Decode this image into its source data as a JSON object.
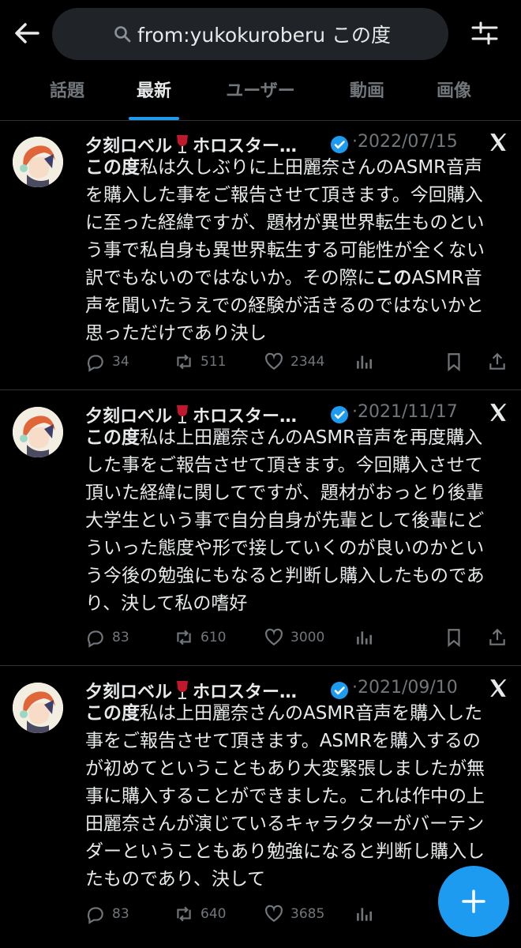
{
  "search": {
    "query": "from:yukokuroberu この度"
  },
  "tabs": [
    "話題",
    "最新",
    "ユーザー",
    "動画",
    "画像"
  ],
  "tweets": [
    {
      "name_part1": "夕刻ロベル",
      "name_part2": "ホロスター…",
      "date": "·2022/07/15",
      "text_bold_start": "この度",
      "text_a": "私は久しぶりに上田麗奈さんのASMR音声を購入した事をご報告させて頂きます。今回購入に至った経緯ですが、題材が異世界転生ものという事で私自身も異世界転生する可能性が全くない訳でもないのではないか。その際に",
      "text_bold_mid": "この",
      "text_b": "ASMR音声を聞いたうえでの経験が活きるのではないかと思っただけであり決し",
      "replies": "34",
      "retweets": "511",
      "likes": "2344"
    },
    {
      "name_part1": "夕刻ロベル",
      "name_part2": "ホロスター…",
      "date": "·2021/11/17",
      "text_bold_start": "この度",
      "text_a": "私は上田麗奈さんのASMR音声を再度購入した事をご報告させて頂きます。今回購入させて頂いた経緯に関してですが、題材がおっとり後輩大学生という事で自分自身が先輩として後輩にどういった態度や形で接していくのが良いのかという今後の勉強にもなると判断し購入したものであり、決して私の嗜好",
      "text_bold_mid": "",
      "text_b": "",
      "replies": "83",
      "retweets": "610",
      "likes": "3000"
    },
    {
      "name_part1": "夕刻ロベル",
      "name_part2": "ホロスター…",
      "date": "·2021/09/10",
      "text_bold_start": "この度",
      "text_a": "私は上田麗奈さんのASMR音声を購入した事をご報告させて頂きます。ASMRを購入するのが初めてということもあり大変緊張しましたが無事に購入することができました。これは作中の上田麗奈さんが演じているキャラクターがバーテンダーということもあり勉強になると判断し購入したものであり、決して",
      "text_bold_mid": "",
      "text_b": "",
      "replies": "83",
      "retweets": "640",
      "likes": "3685"
    }
  ],
  "colors": {
    "accent": "#1d9bf0",
    "background": "#000000",
    "muted": "#71767b",
    "text": "#e7e9ea"
  }
}
